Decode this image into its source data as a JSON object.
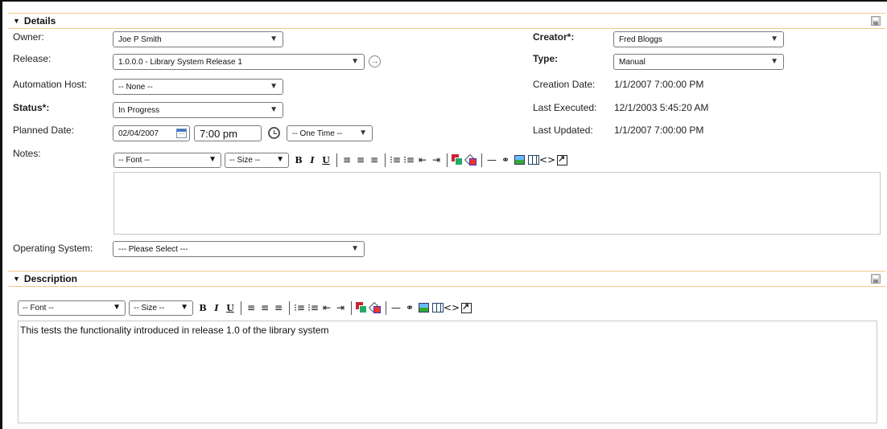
{
  "details": {
    "header": "Details",
    "fields": {
      "owner": {
        "label": "Owner:",
        "value": "Joe P Smith"
      },
      "release": {
        "label": "Release:",
        "value": "1.0.0.0 - Library System Release 1"
      },
      "automation_host": {
        "label": "Automation Host:",
        "value": "-- None --"
      },
      "status": {
        "label": "Status*:",
        "value": "In Progress"
      },
      "planned_date": {
        "label": "Planned Date:",
        "date": "02/04/2007",
        "time": "7:00 pm",
        "recurrence": "-- One Time --"
      },
      "notes": {
        "label": "Notes:"
      },
      "operating_system": {
        "label": "Operating System:",
        "value": "--- Please Select ---"
      },
      "creator": {
        "label": "Creator*:",
        "value": "Fred Bloggs"
      },
      "type": {
        "label": "Type:",
        "value": "Manual"
      },
      "creation_date": {
        "label": "Creation Date:",
        "value": "1/1/2007 7:00:00 PM"
      },
      "last_executed": {
        "label": "Last Executed:",
        "value": "12/1/2003 5:45:20 AM"
      },
      "last_updated": {
        "label": "Last Updated:",
        "value": "1/1/2007 7:00:00 PM"
      }
    }
  },
  "editor_toolbar": {
    "font": "-- Font --",
    "size": "-- Size --",
    "bold": "B",
    "italic": "I",
    "underline": "U"
  },
  "description": {
    "header": "Description",
    "text": "This tests the functionality introduced in release 1.0 of the library system"
  },
  "icons": {
    "collapse": "triangle-down-icon",
    "save": "save-icon",
    "calendar": "calendar-icon",
    "clock": "clock-icon",
    "go": "arrow-right-icon"
  }
}
